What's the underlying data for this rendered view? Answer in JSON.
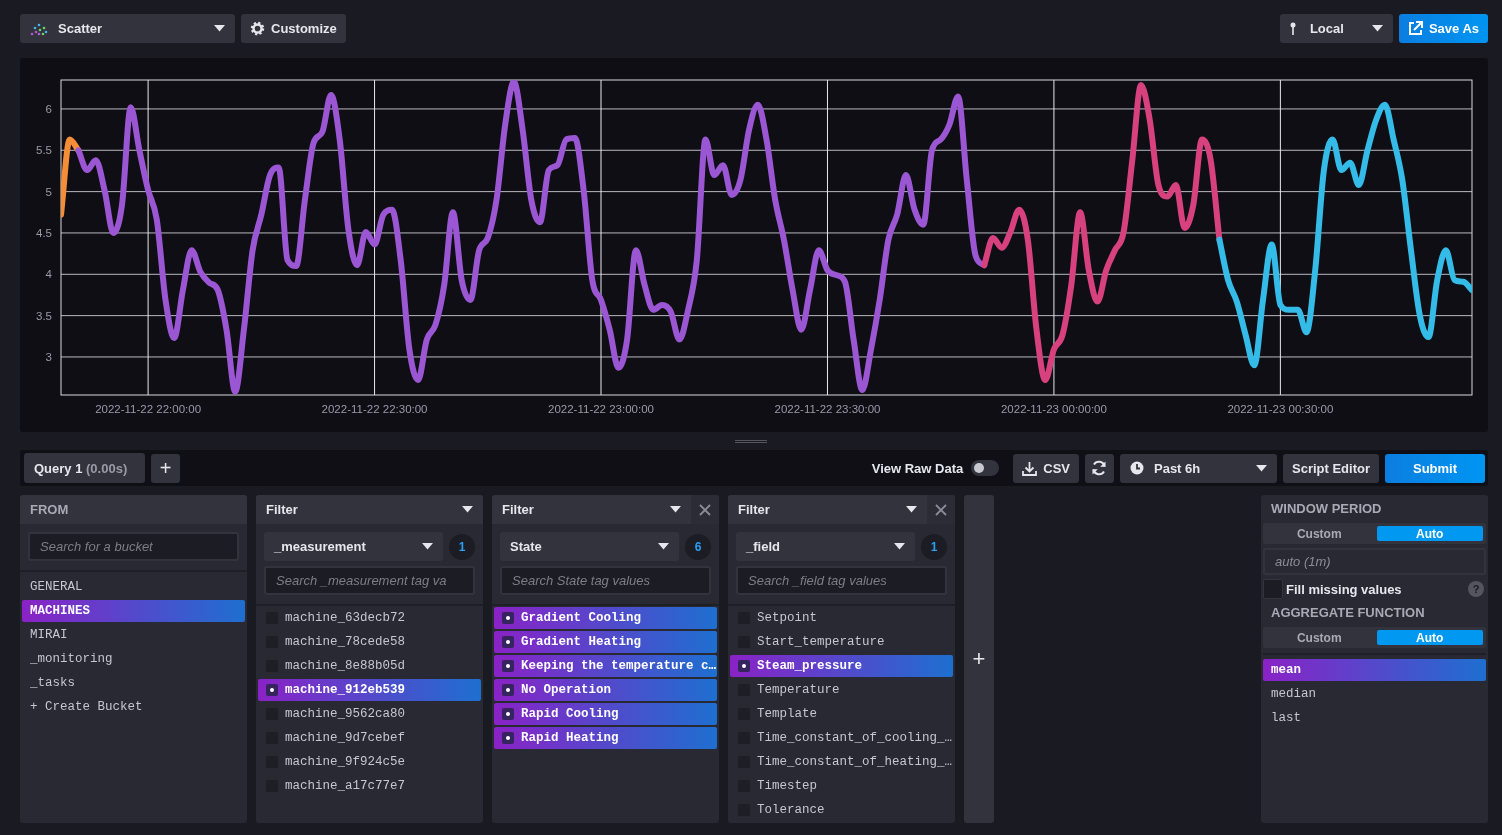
{
  "toolbar": {
    "visualization": "Scatter",
    "customize": "Customize",
    "time_zone": "Local",
    "save_as": "Save As"
  },
  "chart_data": {
    "type": "line",
    "grid": true,
    "ylim": [
      2.54,
      6.35
    ],
    "categories": [
      null,
      null,
      null,
      null,
      null,
      null,
      null,
      null,
      null,
      null,
      "2022-11-22 22:00:00",
      null,
      null,
      null,
      null,
      null,
      null,
      null,
      null,
      null,
      null,
      null,
      null,
      null,
      null,
      null,
      null,
      null,
      null,
      null,
      null,
      null,
      null,
      null,
      null,
      null,
      "2022-11-22 22:30:00",
      null,
      null,
      null,
      null,
      null,
      null,
      null,
      null,
      null,
      null,
      null,
      null,
      null,
      null,
      null,
      null,
      null,
      null,
      null,
      null,
      null,
      null,
      null,
      null,
      null,
      "2022-11-22 23:00:00",
      null,
      null,
      null,
      null,
      null,
      null,
      null,
      null,
      null,
      null,
      null,
      null,
      null,
      null,
      null,
      null,
      null,
      null,
      null,
      null,
      null,
      null,
      null,
      null,
      null,
      "2022-11-22 23:30:00",
      null,
      null,
      null,
      null,
      null,
      null,
      null,
      null,
      null,
      null,
      null,
      null,
      null,
      null,
      null,
      null,
      null,
      null,
      null,
      null,
      null,
      null,
      null,
      null,
      null,
      "2022-11-23 00:00:00",
      null,
      null,
      null,
      null,
      null,
      null,
      null,
      null,
      null,
      null,
      null,
      null,
      null,
      null,
      null,
      null,
      null,
      null,
      null,
      null,
      null,
      null,
      null,
      null,
      null,
      "2022-11-23 00:30:00",
      null,
      null,
      null,
      null,
      null,
      null,
      null,
      null,
      null,
      null,
      null,
      null,
      null,
      null,
      null,
      null,
      null,
      null,
      null,
      null,
      null,
      null
    ],
    "yticks": [
      3,
      3.5,
      4,
      4.5,
      5,
      5.5,
      6
    ],
    "series": [
      {
        "color": "#f48d38",
        "values": [
          4.72,
          5.63,
          5.5,
          null,
          null,
          null,
          null,
          null,
          null,
          null,
          null,
          null,
          null,
          null,
          null,
          null,
          null,
          null,
          null,
          null,
          null,
          null,
          null,
          null,
          null,
          null,
          null,
          null,
          null,
          null,
          null,
          null,
          null,
          null,
          null,
          null,
          null,
          null,
          null,
          null,
          null,
          null,
          null,
          null,
          null,
          null,
          null,
          null,
          null,
          null,
          null,
          null,
          null,
          null,
          null,
          null,
          null,
          null,
          null,
          null,
          null,
          null,
          null,
          null,
          null,
          null,
          null,
          null,
          null,
          null,
          null,
          null,
          null,
          null,
          null,
          null,
          null,
          null,
          null,
          null,
          null,
          null,
          null,
          null,
          null,
          null,
          null,
          null,
          null,
          null,
          null,
          null,
          null,
          null,
          null,
          null,
          null,
          null,
          null,
          null,
          null,
          null,
          null,
          null,
          null,
          null,
          null,
          null,
          null,
          null,
          null,
          null,
          null,
          null,
          null,
          null,
          null,
          null,
          null,
          null,
          null,
          null,
          null,
          null,
          null,
          null,
          null,
          null,
          null,
          null,
          null,
          null,
          null,
          null,
          null,
          null,
          null,
          null,
          null,
          null,
          null,
          null,
          null,
          null,
          null,
          null,
          null,
          null,
          null,
          null,
          null,
          null,
          null,
          null,
          null,
          null,
          null,
          null,
          null,
          null,
          null,
          null,
          null
        ]
      },
      {
        "color": "#9b57d3",
        "values": [
          null,
          null,
          5.5,
          5.26,
          5.38,
          5.02,
          4.5,
          4.84,
          6.02,
          5.5,
          5.02,
          4.66,
          3.69,
          3.23,
          3.81,
          4.29,
          4.03,
          3.9,
          3.81,
          3.33,
          2.58,
          3.33,
          4.29,
          4.72,
          5.2,
          5.29,
          4.17,
          4.1,
          4.9,
          5.59,
          5.72,
          6.17,
          5.63,
          4.54,
          4.11,
          4.51,
          4.36,
          4.72,
          4.78,
          4.17,
          3.09,
          2.72,
          3.21,
          3.39,
          3.87,
          4.75,
          3.93,
          3.69,
          4.29,
          4.44,
          4.9,
          5.81,
          6.33,
          5.75,
          4.9,
          4.63,
          5.26,
          5.32,
          5.63,
          5.65,
          5.02,
          3.93,
          3.69,
          3.33,
          2.87,
          3.21,
          4.29,
          3.87,
          3.57,
          3.63,
          3.55,
          3.21,
          3.57,
          4.17,
          5.63,
          5.2,
          5.32,
          4.96,
          5.14,
          5.75,
          6.05,
          5.63,
          4.9,
          4.42,
          3.81,
          3.33,
          3.81,
          4.29,
          4.05,
          3.99,
          3.91,
          3.21,
          2.6,
          3.09,
          3.69,
          4.42,
          4.72,
          5.2,
          4.78,
          4.6,
          5.5,
          5.63,
          5.81,
          6.15,
          5.14,
          4.23,
          4.11,
          null,
          null,
          null,
          null,
          null,
          null,
          null,
          null,
          null,
          null,
          null,
          null,
          null,
          null,
          null,
          null,
          null,
          null,
          null,
          null,
          null,
          null,
          null,
          null,
          null,
          null,
          null,
          null,
          null,
          null,
          null,
          null,
          null,
          null,
          null,
          null,
          null,
          null,
          null,
          null,
          null,
          null,
          null,
          null,
          null,
          null,
          null,
          null,
          null,
          null,
          null,
          null,
          null,
          null,
          null,
          null
        ]
      },
      {
        "color": "#d6417e",
        "values": [
          null,
          null,
          null,
          null,
          null,
          null,
          null,
          null,
          null,
          null,
          null,
          null,
          null,
          null,
          null,
          null,
          null,
          null,
          null,
          null,
          null,
          null,
          null,
          null,
          null,
          null,
          null,
          null,
          null,
          null,
          null,
          null,
          null,
          null,
          null,
          null,
          null,
          null,
          null,
          null,
          null,
          null,
          null,
          null,
          null,
          null,
          null,
          null,
          null,
          null,
          null,
          null,
          null,
          null,
          null,
          null,
          null,
          null,
          null,
          null,
          null,
          null,
          null,
          null,
          null,
          null,
          null,
          null,
          null,
          null,
          null,
          null,
          null,
          null,
          null,
          null,
          null,
          null,
          null,
          null,
          null,
          null,
          null,
          null,
          null,
          null,
          null,
          null,
          null,
          null,
          null,
          null,
          null,
          null,
          null,
          null,
          null,
          null,
          null,
          null,
          null,
          null,
          null,
          null,
          null,
          null,
          4.11,
          4.44,
          4.32,
          4.51,
          4.78,
          4.42,
          3.33,
          2.72,
          3.09,
          3.27,
          3.87,
          4.75,
          4.05,
          3.67,
          4.05,
          4.29,
          4.51,
          5.38,
          6.29,
          5.87,
          5.08,
          4.94,
          5.08,
          4.56,
          4.84,
          5.63,
          5.38,
          4.42,
          null,
          null,
          null,
          null,
          null,
          null,
          null,
          null,
          null,
          null,
          null,
          null,
          null,
          null,
          null,
          null,
          null,
          null,
          null,
          null,
          null,
          null,
          null,
          null,
          null,
          null,
          null,
          null,
          null
        ]
      },
      {
        "color": "#34bbe7",
        "values": [
          null,
          null,
          null,
          null,
          null,
          null,
          null,
          null,
          null,
          null,
          null,
          null,
          null,
          null,
          null,
          null,
          null,
          null,
          null,
          null,
          null,
          null,
          null,
          null,
          null,
          null,
          null,
          null,
          null,
          null,
          null,
          null,
          null,
          null,
          null,
          null,
          null,
          null,
          null,
          null,
          null,
          null,
          null,
          null,
          null,
          null,
          null,
          null,
          null,
          null,
          null,
          null,
          null,
          null,
          null,
          null,
          null,
          null,
          null,
          null,
          null,
          null,
          null,
          null,
          null,
          null,
          null,
          null,
          null,
          null,
          null,
          null,
          null,
          null,
          null,
          null,
          null,
          null,
          null,
          null,
          null,
          null,
          null,
          null,
          null,
          null,
          null,
          null,
          null,
          null,
          null,
          null,
          null,
          null,
          null,
          null,
          null,
          null,
          null,
          null,
          null,
          null,
          null,
          null,
          null,
          null,
          null,
          null,
          null,
          null,
          null,
          null,
          null,
          null,
          null,
          null,
          null,
          null,
          null,
          null,
          null,
          null,
          null,
          null,
          null,
          null,
          null,
          null,
          null,
          null,
          null,
          null,
          null,
          4.42,
          3.93,
          3.67,
          3.27,
          2.9,
          3.69,
          4.36,
          3.63,
          3.57,
          3.57,
          3.3,
          4.05,
          5.26,
          5.63,
          5.26,
          5.35,
          5.08,
          5.5,
          5.87,
          6.05,
          5.63,
          5.14,
          4.29,
          3.51,
          3.24,
          3.93,
          4.29,
          3.93,
          3.91,
          3.81
        ]
      }
    ]
  },
  "query_bar": {
    "tabs": [
      {
        "label": "Query 1",
        "timing": "(0.00s)",
        "selected": true
      }
    ],
    "add_query": "+",
    "view_raw_data": {
      "label": "View Raw Data",
      "on": false
    },
    "csv": "CSV",
    "time_range": "Past 6h",
    "script_editor": "Script Editor",
    "submit": "Submit"
  },
  "from": {
    "title": "FROM",
    "search_placeholder": "Search for a bucket",
    "buckets": [
      {
        "label": "GENERAL",
        "selected": false
      },
      {
        "label": "MACHINES",
        "selected": true
      },
      {
        "label": "MIRAI",
        "selected": false
      },
      {
        "label": "_monitoring",
        "selected": false
      },
      {
        "label": "_tasks",
        "selected": false
      }
    ],
    "create_bucket": "+ Create Bucket"
  },
  "filters": [
    {
      "title": "Filter",
      "closable": false,
      "key": "_measurement",
      "count": "1",
      "search_placeholder": "Search _measurement tag va",
      "values": [
        {
          "label": "machine_63decb72",
          "selected": false
        },
        {
          "label": "machine_78cede58",
          "selected": false
        },
        {
          "label": "machine_8e88b05d",
          "selected": false
        },
        {
          "label": "machine_912eb539",
          "selected": true
        },
        {
          "label": "machine_9562ca80",
          "selected": false
        },
        {
          "label": "machine_9d7cebef",
          "selected": false
        },
        {
          "label": "machine_9f924c5e",
          "selected": false
        },
        {
          "label": "machine_a17c77e7",
          "selected": false
        }
      ]
    },
    {
      "title": "Filter",
      "closable": true,
      "key": "State",
      "count": "6",
      "search_placeholder": "Search State tag values",
      "values": [
        {
          "label": "Gradient Cooling",
          "selected": true
        },
        {
          "label": "Gradient Heating",
          "selected": true
        },
        {
          "label": "Keeping the temperature c…",
          "selected": true
        },
        {
          "label": "No Operation",
          "selected": true
        },
        {
          "label": "Rapid Cooling",
          "selected": true
        },
        {
          "label": "Rapid Heating",
          "selected": true
        }
      ]
    },
    {
      "title": "Filter",
      "closable": true,
      "key": "_field",
      "count": "1",
      "search_placeholder": "Search _field tag values",
      "values": [
        {
          "label": "Setpoint",
          "selected": false
        },
        {
          "label": "Start_temperature",
          "selected": false
        },
        {
          "label": "Steam_pressure",
          "selected": true
        },
        {
          "label": "Temperature",
          "selected": false
        },
        {
          "label": "Template",
          "selected": false
        },
        {
          "label": "Time_constant_of_cooling_…",
          "selected": false
        },
        {
          "label": "Time_constant_of_heating_…",
          "selected": false
        },
        {
          "label": "Timestep",
          "selected": false
        },
        {
          "label": "Tolerance",
          "selected": false
        }
      ]
    }
  ],
  "add_filter": "+",
  "window_period": {
    "title": "WINDOW PERIOD",
    "modes": [
      {
        "label": "Custom",
        "selected": false
      },
      {
        "label": "Auto",
        "selected": true
      }
    ],
    "placeholder": "auto (1m)",
    "fill_missing": {
      "label": "Fill missing values",
      "checked": false
    },
    "help": "?"
  },
  "aggregate_function": {
    "title": "AGGREGATE FUNCTION",
    "modes": [
      {
        "label": "Custom",
        "selected": false
      },
      {
        "label": "Auto",
        "selected": true
      }
    ],
    "functions": [
      {
        "label": "mean",
        "selected": true
      },
      {
        "label": "median",
        "selected": false
      },
      {
        "label": "last",
        "selected": false
      }
    ]
  }
}
